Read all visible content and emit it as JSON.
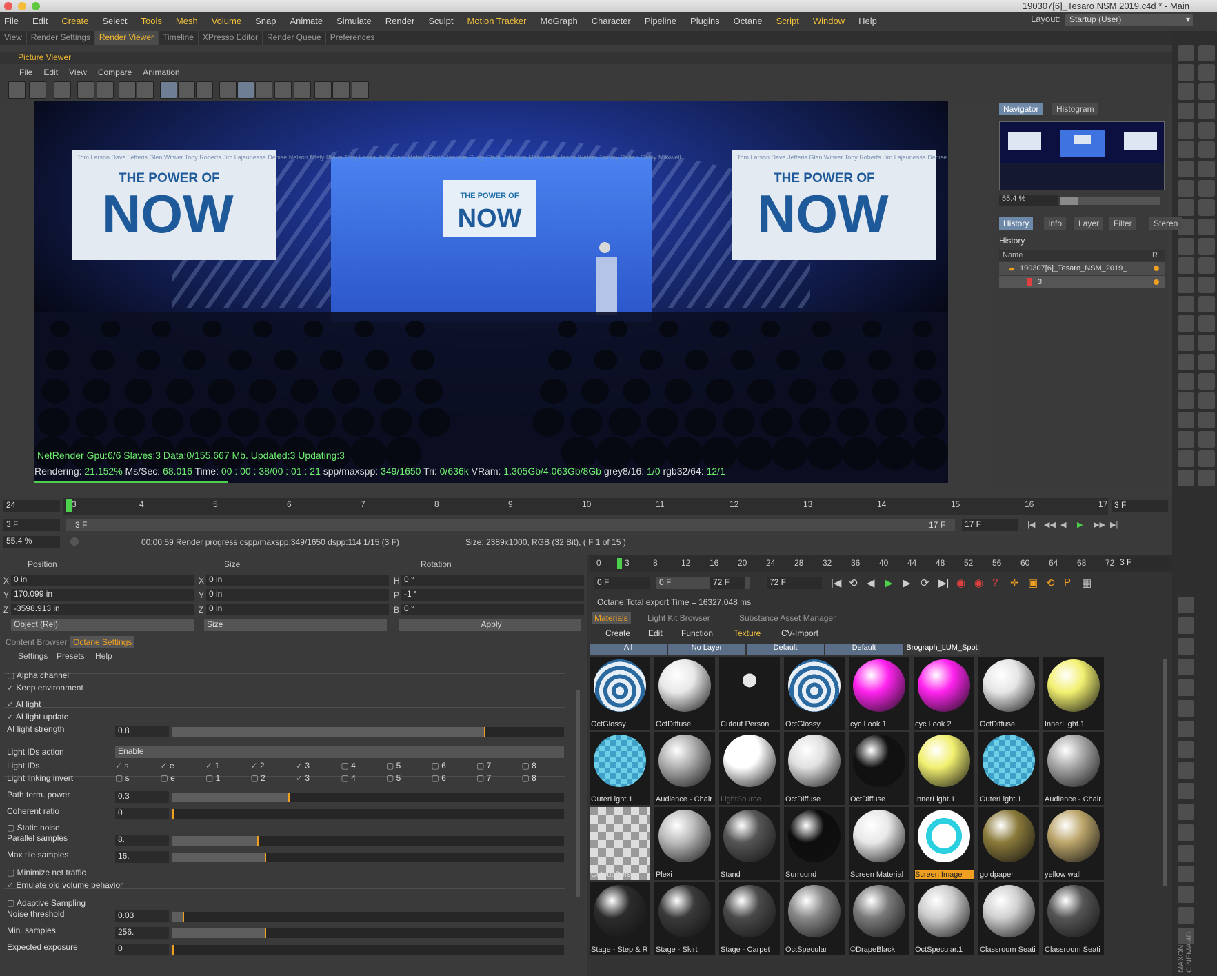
{
  "window": {
    "title": "190307[6]_Tesaro NSM 2019.c4d * - Main"
  },
  "menubar": [
    "File",
    "Edit",
    "Create",
    "Select",
    "Tools",
    "Mesh",
    "Volume",
    "Snap",
    "Animate",
    "Simulate",
    "Render",
    "Sculpt",
    "Motion Tracker",
    "MoGraph",
    "Character",
    "Pipeline",
    "Plugins",
    "Octane",
    "Script",
    "Window",
    "Help"
  ],
  "layout": {
    "label": "Layout:",
    "value": "Startup (User)"
  },
  "tabs": [
    "View",
    "Render Settings",
    "Render Viewer",
    "Timeline",
    "XPresso Editor",
    "Render Queue",
    "Preferences"
  ],
  "picture_viewer": {
    "title": "Picture Viewer",
    "menu": [
      "File",
      "Edit",
      "View",
      "Compare",
      "Animation"
    ]
  },
  "render": {
    "banner": {
      "names": "Tom Larson  Dave Jefferis  Glen Witwer  Tony Roberts  Jim Lajeunesse  Denise Nelson  Misty Braun  Tony Lanza  John Perk  Matina Smith  Jennifer  Curry  Clark  Rebecca Mehrwerth  Jason Waters  Tammy Reben  Cathy Maxwell",
      "sub": "THE POWER OF",
      "big": "NOW"
    },
    "screen": {
      "sub": "THE POWER OF",
      "big": "NOW"
    },
    "overlay1": "NetRender Gpu:6/6 Slaves:3  Data:0/155.667 Mb.    Updated:3 Updating:3",
    "overlay2": {
      "l1": "Rendering: ",
      "v1": "21.152%",
      "l2": " Ms/Sec: ",
      "v2": "68.016",
      "l3": " Time: ",
      "v3": "00 : 00 : 38/00 : 01 : 21",
      "l4": " spp/maxspp: ",
      "v4": "349/1650",
      "l5": " Tri: ",
      "v5": "0/636k",
      "l6": " VRam: ",
      "v6": "1.305Gb/4.063Gb/8Gb",
      "l7": " grey8/16: ",
      "v7": "1/0",
      "l8": " rgb32/64: ",
      "v8": "12/1"
    },
    "progress": 0.21152
  },
  "navigator": {
    "tabs": [
      "Navigator",
      "Histogram"
    ],
    "zoom": "55.4 %"
  },
  "history": {
    "tabs": [
      "History",
      "Info",
      "Layer",
      "Filter",
      "Stereo"
    ],
    "title": "History",
    "col_name": "Name",
    "col_r": "R",
    "row1": "190307[6]_Tesaro_NSM_2019_",
    "row2": "3"
  },
  "timeline": {
    "frame_field": "24",
    "current": "3",
    "ticks": [
      "4",
      "5",
      "6",
      "7",
      "8",
      "9",
      "10",
      "11",
      "12",
      "13",
      "14",
      "15",
      "16",
      "17"
    ],
    "end_field": "3 F",
    "start": "3 F",
    "range_start": "3 F",
    "range_end": "17 F",
    "end2": "17 F"
  },
  "status": {
    "zoom": "55.4 %",
    "text": "00:00:59 Render progress  cspp/maxspp:349/1650  dspp:114 1/15 (3 F)",
    "size": "Size: 2389x1000, RGB (32 Bit),  ( F 1 of 15 )"
  },
  "coords": {
    "headers": [
      "Position",
      "Size",
      "Rotation"
    ],
    "rows": [
      [
        "X",
        "0 in",
        "X",
        "0 in",
        "H",
        "0 °"
      ],
      [
        "Y",
        "170.099 in",
        "Y",
        "0 in",
        "P",
        "-1 °"
      ],
      [
        "Z",
        "-3598.913 in",
        "Z",
        "0 in",
        "B",
        "0 °"
      ]
    ],
    "mode1": "Object (Rel)",
    "mode2": "Size",
    "apply": "Apply"
  },
  "octane": {
    "tabs": [
      "Content Browser",
      "Octane Settings"
    ],
    "menu": [
      "Settings",
      "Presets",
      "Help"
    ],
    "alpha": "Alpha channel",
    "keep_env": "Keep environment",
    "ai_light": "AI light",
    "ai_update": "AI light update",
    "ai_strength_label": "AI light strength",
    "ai_strength": "0.8",
    "ai_strength_frac": 0.8,
    "lightids_action_label": "Light IDs action",
    "lightids_action": "Enable",
    "lightids_label": "Light IDs",
    "link_invert_label": "Light linking invert",
    "ids": [
      "s",
      "e",
      "1",
      "2",
      "3",
      "4",
      "5",
      "6",
      "7",
      "8"
    ],
    "path_term_label": "Path term. power",
    "path_term": "0.3",
    "path_term_frac": 0.3,
    "coherent_label": "Coherent ratio",
    "coherent": "0",
    "coherent_frac": 0,
    "static_noise": "Static noise",
    "parallel_label": "Parallel samples",
    "parallel": "8.",
    "parallel_frac": 0.22,
    "maxtile_label": "Max tile samples",
    "maxtile": "16.",
    "maxtile_frac": 0.24,
    "min_net": "Minimize net traffic",
    "emulate": "Emulate old volume behavior",
    "adaptive": "Adaptive Sampling",
    "noise_label": "Noise threshold",
    "noise": "0.03",
    "noise_frac": 0.03,
    "minsamp_label": "Min. samples",
    "minsamp": "256.",
    "minsamp_frac": 0.24,
    "exposure_label": "Expected exposure",
    "exposure": "0",
    "exposure_frac": 0
  },
  "anim": {
    "ticks": [
      "0",
      "3",
      "8",
      "12",
      "16",
      "20",
      "24",
      "28",
      "32",
      "36",
      "40",
      "44",
      "48",
      "52",
      "56",
      "60",
      "64",
      "68",
      "72"
    ],
    "f1": "0 F",
    "f2": "0 F",
    "f3": "72 F",
    "f4": "72 F",
    "end": "3 F",
    "console": "Octane:Total export Time = 16327.048 ms"
  },
  "materials": {
    "tabs": [
      "Materials",
      "Light Kit Browser",
      "Substance Asset Manager"
    ],
    "menu": [
      "Create",
      "Edit",
      "Function",
      "Texture",
      "CV-Import"
    ],
    "layers": [
      "All",
      "No Layer",
      "Default",
      "Default",
      "Brograph_LUM_Spot"
    ],
    "items": [
      {
        "label": "OctGlossy",
        "color": "#2a6aa0",
        "style": "logo"
      },
      {
        "label": "OctDiffuse",
        "color": "#e8e8e8"
      },
      {
        "label": "Cutout Person",
        "color": "#2a2222",
        "style": "person"
      },
      {
        "label": "OctGlossy",
        "color": "#2a6aa0",
        "style": "logo"
      },
      {
        "label": "cyc Look 1",
        "color": "#ff22ee"
      },
      {
        "label": "cyc Look 2",
        "color": "#ff22ee"
      },
      {
        "label": "OctDiffuse",
        "color": "#e6e6e6"
      },
      {
        "label": "InnerLight.1",
        "color": "#f2f070"
      },
      {
        "label": "OuterLight.1",
        "color": "#6ecfe8",
        "style": "check"
      },
      {
        "label": "Audience - Chair",
        "color": "#b0b0b0"
      },
      {
        "label": "LightSource",
        "color": "#ffffff",
        "dim": true
      },
      {
        "label": "OctDiffuse",
        "color": "#e0e0e0"
      },
      {
        "label": "OctDiffuse",
        "color": "#111111"
      },
      {
        "label": "InnerLight.1",
        "color": "#f2f070"
      },
      {
        "label": "OuterLight.1",
        "color": "#6ecfe8",
        "style": "check"
      },
      {
        "label": "Audience - Chair",
        "color": "#a8a8a8"
      },
      {
        "label": "Cutout Person",
        "color": "#cccccc",
        "style": "checkbg"
      },
      {
        "label": "Plexi",
        "color": "#bbbbbb"
      },
      {
        "label": "Stand",
        "color": "#555555"
      },
      {
        "label": "Surround",
        "color": "#0d0d0d"
      },
      {
        "label": "Screen Material",
        "color": "#e8e8e8"
      },
      {
        "label": "Screen Image",
        "color": "#ffffff",
        "style": "swirl",
        "sel": true
      },
      {
        "label": "goldpaper",
        "color": "#8a7a3a"
      },
      {
        "label": "yellow wall",
        "color": "#bba56a"
      },
      {
        "label": "Stage - Step & R",
        "color": "#2c2c2c"
      },
      {
        "label": "Stage - Skirt",
        "color": "#3a3a3a"
      },
      {
        "label": "Stage - Carpet",
        "color": "#4a4a4a"
      },
      {
        "label": "OctSpecular",
        "color": "#888888"
      },
      {
        "label": "©DrapeBlack",
        "color": "#7a7a7a"
      },
      {
        "label": "OctSpecular.1",
        "color": "#cccccc"
      },
      {
        "label": "Classroom Seati",
        "color": "#d0d0d0"
      },
      {
        "label": "Classroom Seati",
        "color": "#555555"
      }
    ]
  },
  "branding": "MAXON CINEMA 4D"
}
